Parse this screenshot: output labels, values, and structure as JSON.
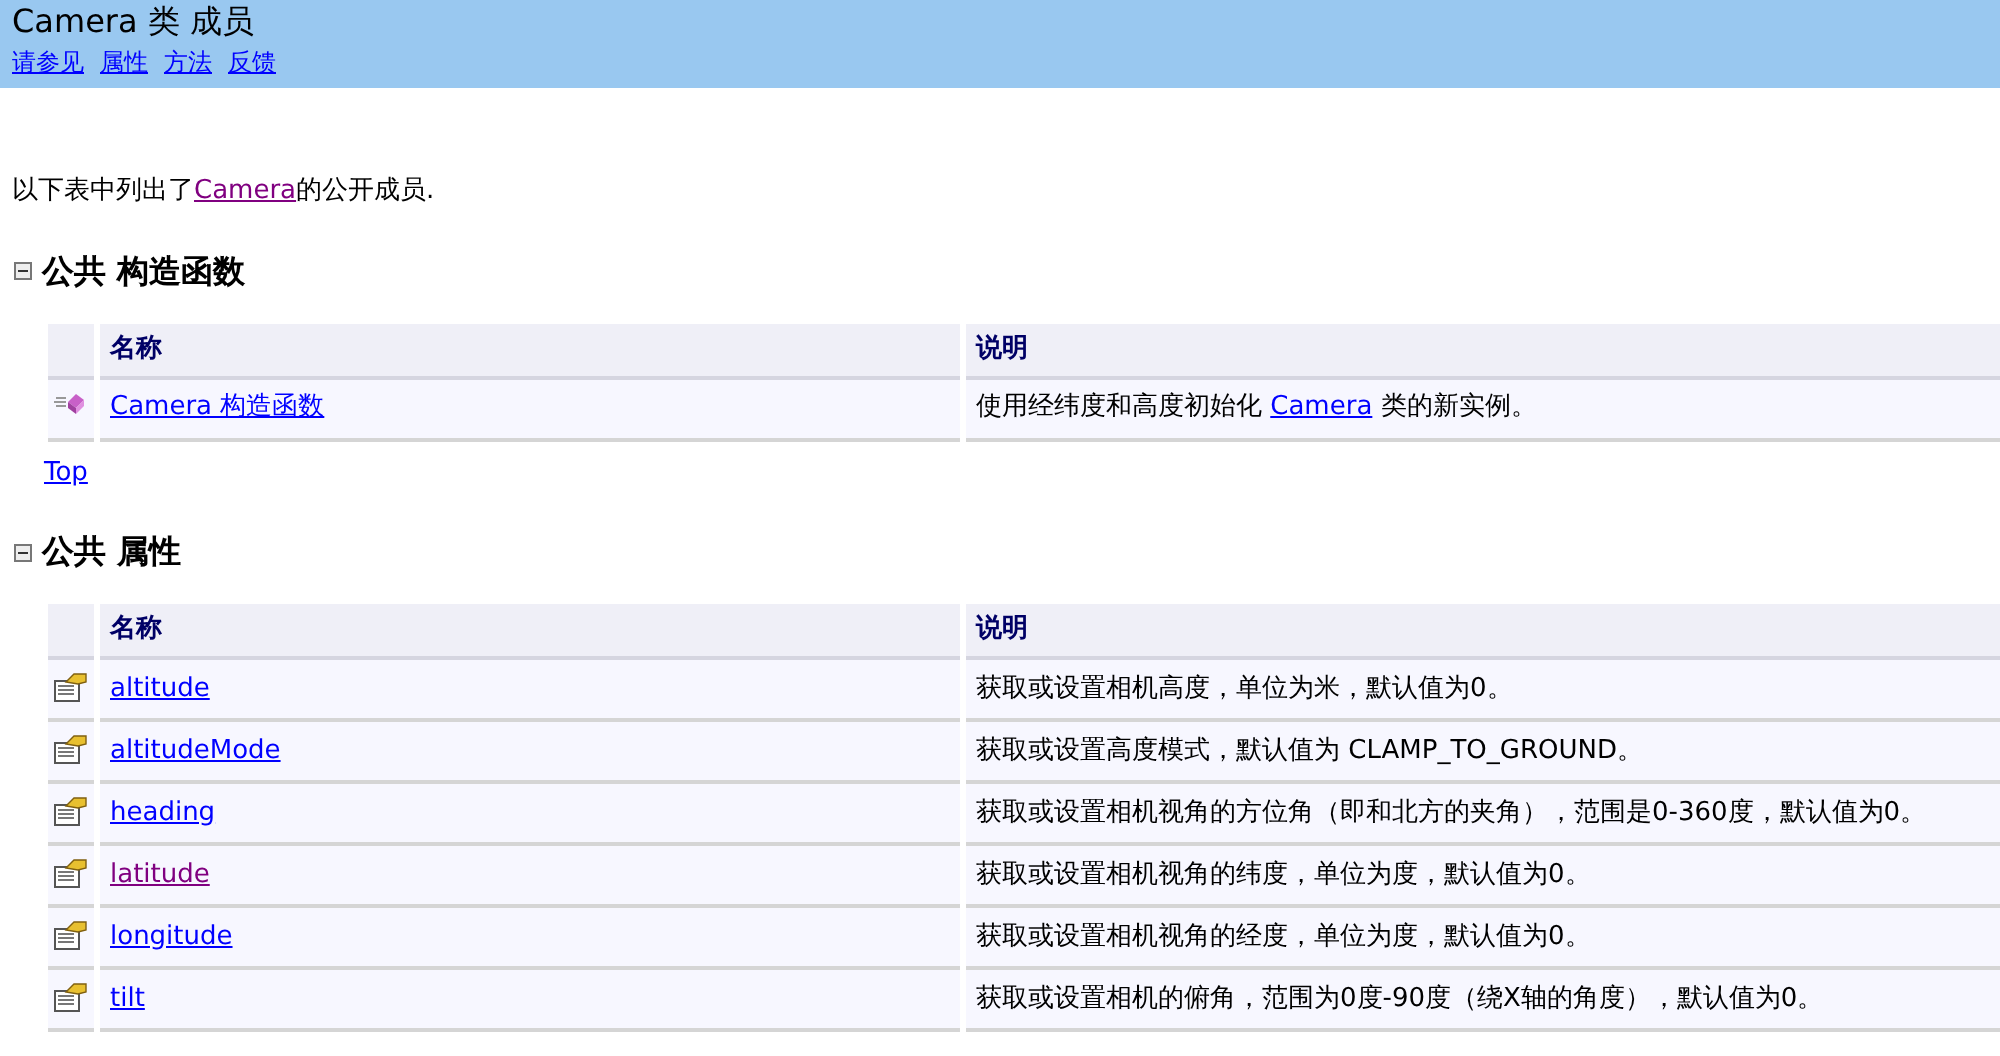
{
  "header": {
    "title": "Camera 类 成员",
    "links": [
      {
        "label": "请参见",
        "visited": false
      },
      {
        "label": "属性",
        "visited": false
      },
      {
        "label": "方法",
        "visited": false
      },
      {
        "label": "反馈",
        "visited": false
      }
    ]
  },
  "intro": {
    "before": "以下表中列出了",
    "link": {
      "label": "Camera",
      "visited": true
    },
    "after": "的公开成员."
  },
  "sections": [
    {
      "title": "公共 构造函数",
      "expanded": true,
      "columns": [
        "名称",
        "说明"
      ],
      "rows": [
        {
          "kind": "method",
          "name": {
            "label": "Camera 构造函数",
            "visited": false
          },
          "description": {
            "before": "使用经纬度和高度初始化 ",
            "link": {
              "label": "Camera",
              "visited": false
            },
            "after": " 类的新实例。"
          }
        }
      ],
      "top_link": {
        "label": "Top",
        "visited": false
      }
    },
    {
      "title": "公共 属性",
      "expanded": true,
      "columns": [
        "名称",
        "说明"
      ],
      "rows": [
        {
          "kind": "property",
          "name": {
            "label": "altitude",
            "visited": false
          },
          "description": {
            "before": "获取或设置相机高度，单位为米，默认值为0。"
          }
        },
        {
          "kind": "property",
          "name": {
            "label": "altitudeMode",
            "visited": false
          },
          "description": {
            "before": "获取或设置高度模式，默认值为 CLAMP_TO_GROUND。"
          }
        },
        {
          "kind": "property",
          "name": {
            "label": "heading",
            "visited": false
          },
          "description": {
            "before": "获取或设置相机视角的方位角（即和北方的夹角），范围是0-360度，默认值为0。"
          }
        },
        {
          "kind": "property",
          "name": {
            "label": "latitude",
            "visited": true
          },
          "description": {
            "before": "获取或设置相机视角的纬度，单位为度，默认值为0。"
          }
        },
        {
          "kind": "property",
          "name": {
            "label": "longitude",
            "visited": false
          },
          "description": {
            "before": "获取或设置相机视角的经度，单位为度，默认值为0。"
          }
        },
        {
          "kind": "property",
          "name": {
            "label": "tilt",
            "visited": false
          },
          "description": {
            "before": "获取或设置相机的俯角，范围为0度-90度（绕X轴的角度），默认值为0。"
          }
        }
      ]
    }
  ]
}
